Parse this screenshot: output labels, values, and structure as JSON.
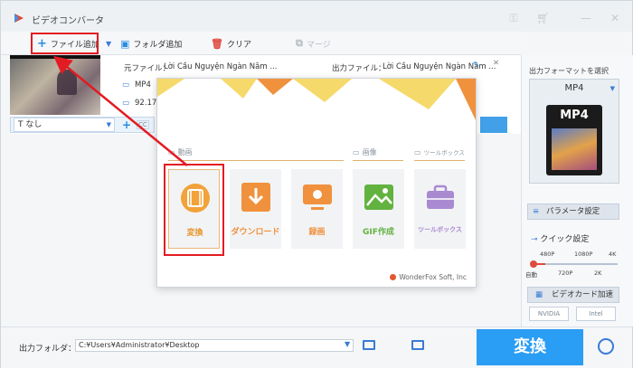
{
  "window": {
    "title": "ビデオコンバータ"
  },
  "toolbar": {
    "add_file": "ファイル追加",
    "add_folder": "フォルダ追加",
    "clear": "クリア",
    "merge": "マージ"
  },
  "file": {
    "source_label": "元ファイル：",
    "source_name": "Lời Cầu Nguyện Ngàn Năm ...",
    "output_label": "出力ファイル：",
    "output_name": "Lời Cầu Nguyện Ngàn Năm ...",
    "format": "MP4",
    "size": "92.17",
    "subtitle": "なし"
  },
  "popup": {
    "sections": {
      "video": "動画",
      "image": "画像",
      "toolbox": "ツールボックス"
    },
    "tiles": [
      {
        "label": "変換",
        "color": "#e8952d"
      },
      {
        "label": "ダウンロード",
        "color": "#f0913d"
      },
      {
        "label": "録画",
        "color": "#f0913d"
      },
      {
        "label": "GIF作成",
        "color": "#62b240"
      },
      {
        "label": "ツールボックス",
        "color": "#a98ad1"
      }
    ],
    "brand": "WonderFox Soft, Inc"
  },
  "right_panel": {
    "select_label": "出力フォーマットを選択",
    "format_value": "MP4",
    "format_card": "MP4",
    "param_button": "パラメータ設定",
    "quick_label": "クイック設定",
    "quality_top": [
      "480P",
      "1080P",
      "4K"
    ],
    "quality_bottom": [
      "自動",
      "720P",
      "2K"
    ],
    "gpu_button": "ビデオカード加速",
    "gpu_nvidia": "NVIDIA",
    "gpu_intel": "Intel"
  },
  "bottom": {
    "output_folder_label": "出力フォルダ：",
    "output_folder_value": "C:¥Users¥Administrator¥Desktop",
    "convert_button": "変換"
  },
  "colors": {
    "accent_blue": "#2a9df4",
    "highlight_red": "#e31b23",
    "orange": "#f0913d"
  },
  "icons": [
    "app-logo-icon",
    "key-icon",
    "cart-icon",
    "minimize-icon",
    "close-icon",
    "plus-icon",
    "folder-add-icon",
    "trash-icon",
    "merge-icon",
    "edit-icon",
    "alarm-icon"
  ]
}
